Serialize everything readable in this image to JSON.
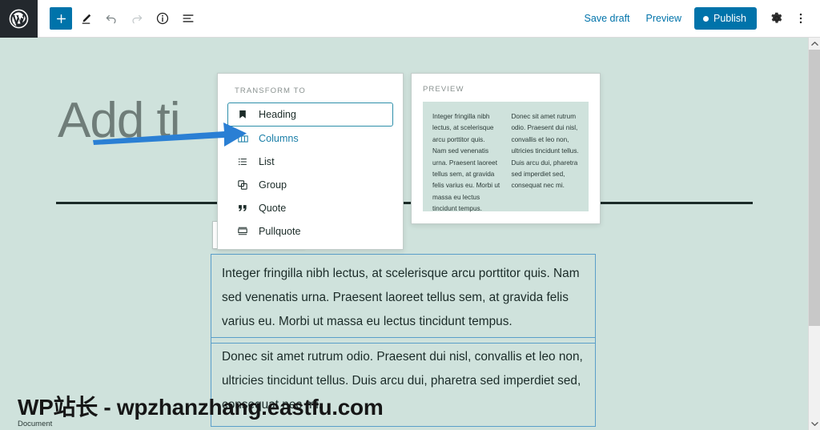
{
  "topbar": {
    "logo_icon": "wordpress-logo-icon",
    "left_tools": [
      {
        "name": "add-block-button",
        "icon": "plus-icon",
        "label": "+",
        "state": "primary"
      },
      {
        "name": "edit-tool-button",
        "icon": "pencil-icon",
        "label": "",
        "state": "default"
      },
      {
        "name": "undo-button",
        "icon": "undo-arrow-icon",
        "label": "",
        "state": "default"
      },
      {
        "name": "redo-button",
        "icon": "redo-arrow-icon",
        "label": "",
        "state": "disabled"
      },
      {
        "name": "details-button",
        "icon": "info-circle-icon",
        "label": "",
        "state": "default"
      },
      {
        "name": "list-view-button",
        "icon": "list-view-icon",
        "label": "",
        "state": "default"
      }
    ],
    "save_draft_label": "Save draft",
    "preview_label": "Preview",
    "publish_label": "Publish",
    "settings_icon": "gear-icon",
    "more_options_icon": "more-vertical-icon",
    "accent_color": "#0073aa"
  },
  "canvas": {
    "title_placeholder": "Add ti",
    "background_color": "#cfe2dc",
    "separator_color": "#1b2b28"
  },
  "block_toolbar": {
    "items": [
      {
        "name": "block-type-paragraph-button",
        "icon": "paragraph-pilcrow-icon",
        "label": "¶"
      },
      {
        "name": "align-text-button",
        "icon": "align-left-icon",
        "label": ""
      },
      {
        "name": "block-more-options-button",
        "icon": "more-vertical-icon",
        "label": ""
      }
    ]
  },
  "paragraphs": [
    {
      "name": "paragraph-block-1",
      "text": "Integer fringilla nibh lectus, at scelerisque arcu porttitor quis. Nam sed venenatis urna. Praesent laoreet tellus sem, at gravida felis varius eu. Morbi ut massa eu lectus tincidunt tempus."
    },
    {
      "name": "paragraph-block-2",
      "text": "Donec sit amet rutrum odio. Praesent dui nisl, convallis et leo non, ultricies tincidunt tellus. Duis arcu dui, pharetra sed imperdiet sed, consequat nec mi."
    }
  ],
  "transform_popover": {
    "heading": "Transform to",
    "items": [
      {
        "name": "transform-option-heading",
        "label": "Heading",
        "icon": "heading-bookmark-icon",
        "state": "selected"
      },
      {
        "name": "transform-option-columns",
        "label": "Columns",
        "icon": "columns-icon",
        "state": "hovered"
      },
      {
        "name": "transform-option-list",
        "label": "List",
        "icon": "list-icon",
        "state": "default"
      },
      {
        "name": "transform-option-group",
        "label": "Group",
        "icon": "group-stack-icon",
        "state": "default"
      },
      {
        "name": "transform-option-quote",
        "label": "Quote",
        "icon": "quote-marks-icon",
        "state": "default"
      },
      {
        "name": "transform-option-pullquote",
        "label": "Pullquote",
        "icon": "pullquote-icon",
        "state": "default"
      }
    ],
    "highlight_color": "#1b7fa8"
  },
  "preview_popover": {
    "heading": "Preview",
    "column_left": "Integer fringilla nibh lectus, at scelerisque arcu porttitor quis. Nam sed venenatis urna. Praesent laoreet tellus sem, at gravida felis varius eu. Morbi ut massa eu lectus tincidunt tempus.",
    "column_right": "Donec sit amet rutrum odio. Praesent dui nisl, convallis et leo non, ultricies tincidunt tellus. Duis arcu dui, pharetra sed imperdiet sed, consequat nec mi."
  },
  "annotation": {
    "arrow_icon": "right-arrow-annotation-icon",
    "arrow_color": "#2a7fd4"
  },
  "scrollbar": {
    "up_arrow_icon": "chevron-up-icon",
    "down_arrow_icon": "chevron-down-icon",
    "thumb_name": "scrollbar-thumb"
  },
  "footer": {
    "watermark": "WP站长 - wpzhanzhang.eastfu.com",
    "document_tab_label": "Document"
  }
}
